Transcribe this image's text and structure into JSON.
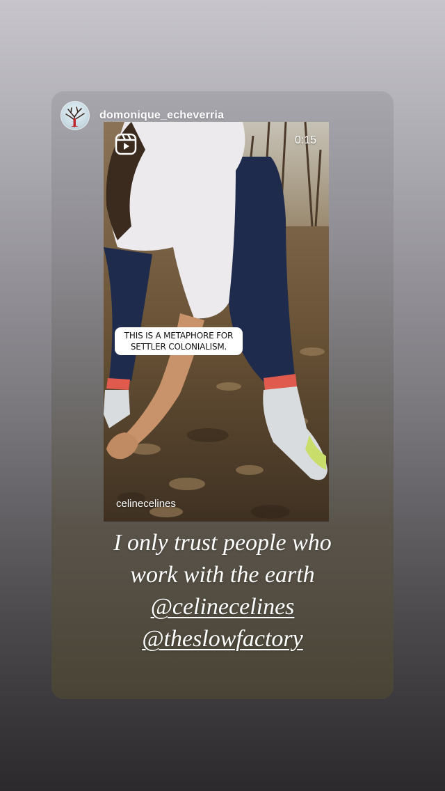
{
  "story": {
    "poster_username": "domonique_echeverria",
    "avatar_icon": "tree-avatar-icon"
  },
  "reel": {
    "icon": "reels-icon",
    "timer": "0:15",
    "caption_line1": "THIS IS A METAPHORE FOR",
    "caption_line2": "SETTLER COLONIALISM.",
    "author_handle": "celinecelines"
  },
  "text": {
    "line1": "I only trust people who",
    "line2": "work with the earth",
    "mention1": "@celinecelines",
    "mention2": "@theslowfactory"
  }
}
